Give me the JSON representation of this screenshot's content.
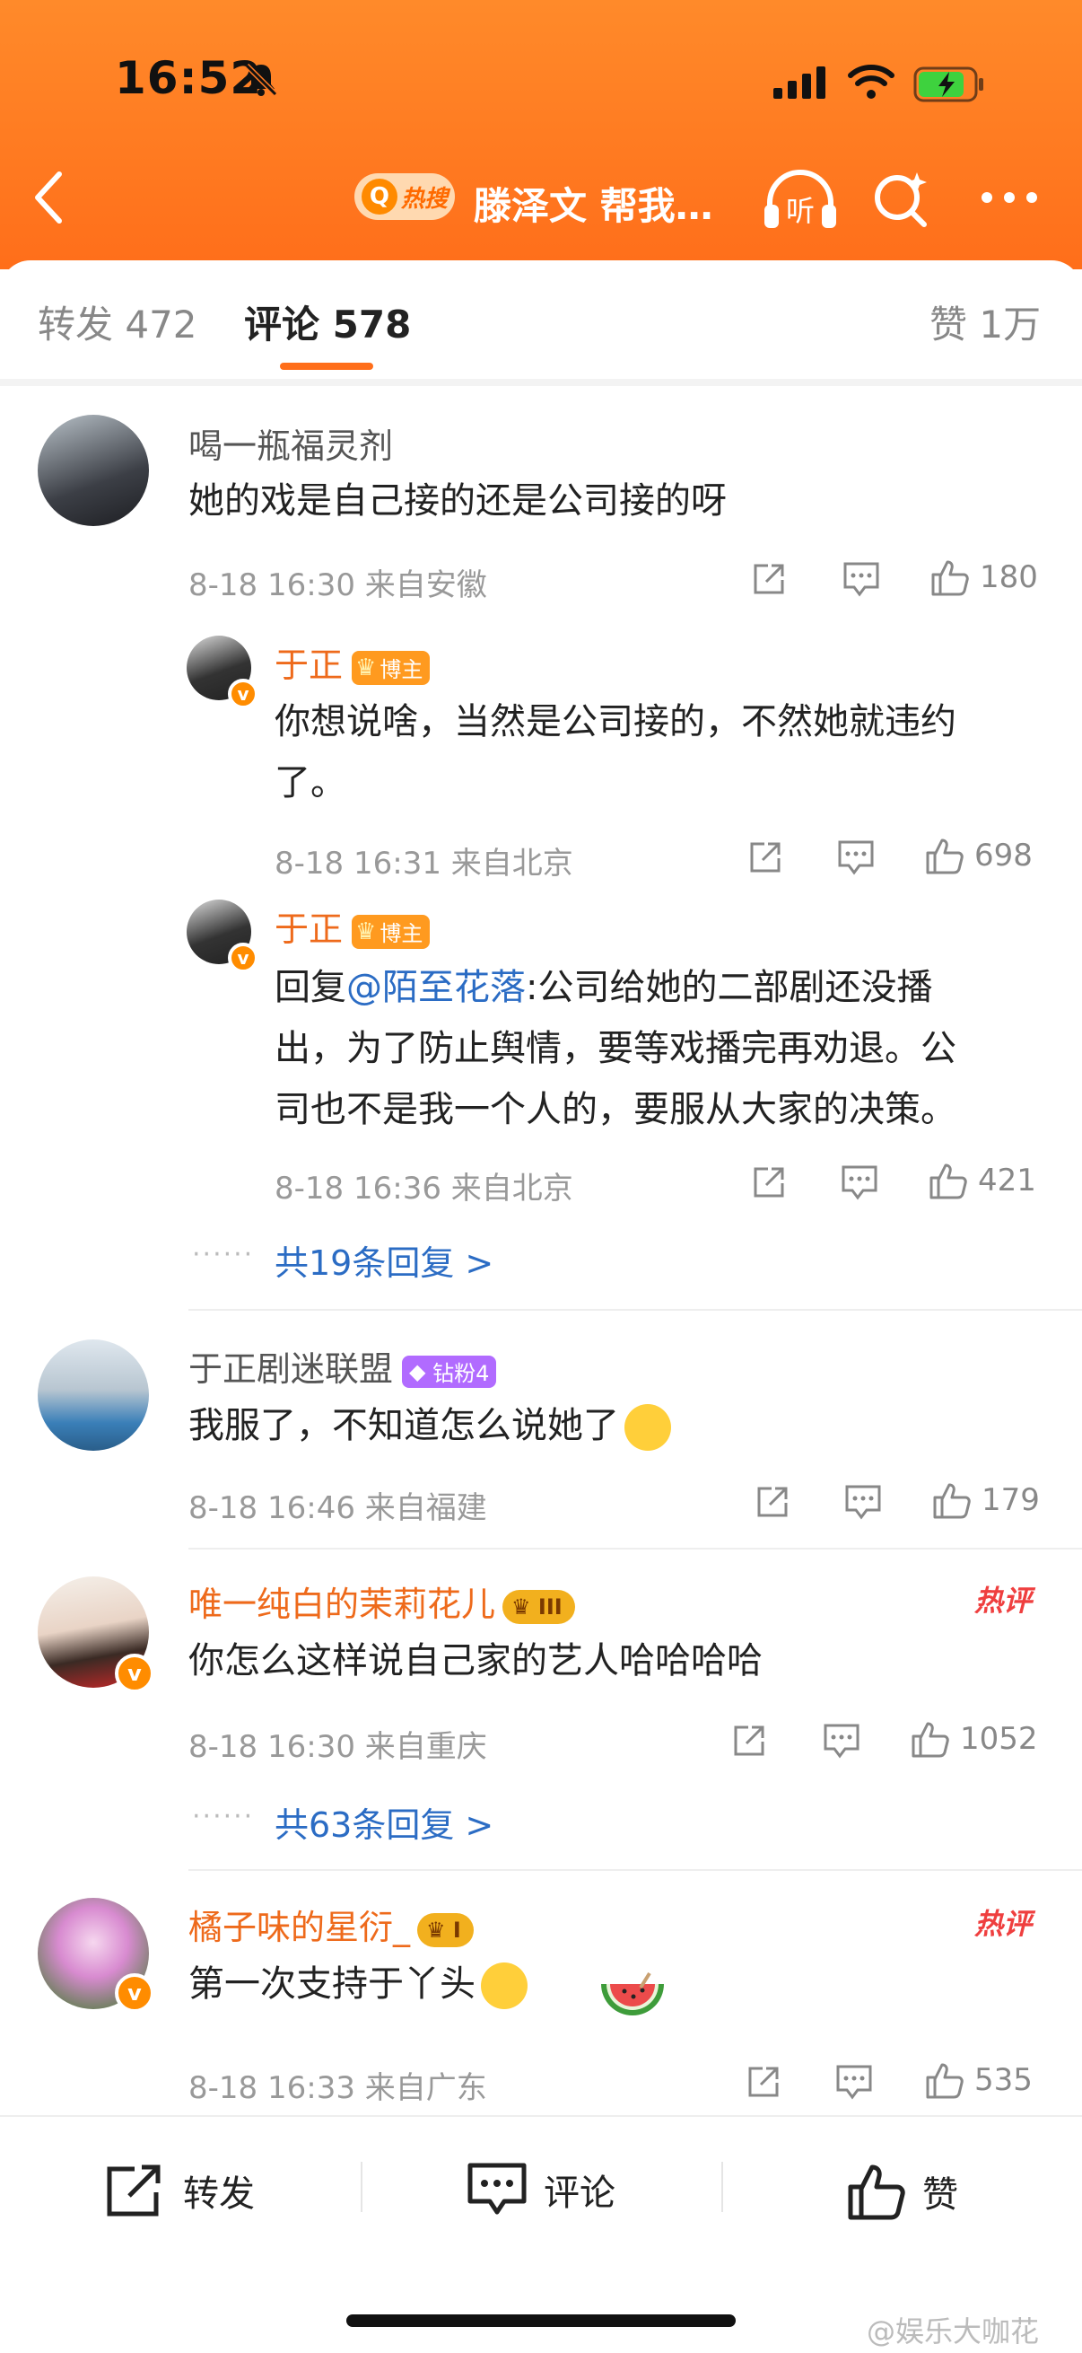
{
  "status_bar": {
    "time": "16:52"
  },
  "nav": {
    "hot_label": "热搜",
    "title": "滕泽文 帮我…",
    "listen_label": "听"
  },
  "tabs": {
    "repost": "转发 472",
    "comment": "评论 578",
    "like": "赞 1万"
  },
  "comments": [
    {
      "user": "喝一瓶福灵剂",
      "text": "她的戏是自己接的还是公司接的呀",
      "meta": "8-18 16:30  来自安徽",
      "likes": "180",
      "replies": [
        {
          "user": "于正",
          "badge": "博主",
          "text_l1": "你想说啥，当然是公司接的，不然她就违约",
          "text_l2": "了。",
          "meta": "8-18 16:31  来自北京",
          "likes": "698"
        },
        {
          "user": "于正",
          "badge": "博主",
          "reply_prefix": "回复",
          "mention": "@陌至花落",
          "text_l1": ":公司给她的二部剧还没播",
          "text_l2": "出，为了防止舆情，要等戏播完再劝退。公",
          "text_l3": "司也不是我一个人的，要服从大家的决策。",
          "meta": "8-18 16:36  来自北京",
          "likes": "421"
        }
      ],
      "more": "共19条回复 >"
    },
    {
      "user": "于正剧迷联盟",
      "badge": "钻粉4",
      "text": "我服了，不知道怎么说她了",
      "meta": "8-18 16:46  来自福建",
      "likes": "179"
    },
    {
      "user": "唯一纯白的茉莉花儿",
      "level": "III",
      "hot": "热评",
      "text": "你怎么这样说自己家的艺人哈哈哈哈",
      "meta": "8-18 16:30  来自重庆",
      "likes": "1052",
      "more": "共63条回复 >"
    },
    {
      "user": "橘子味的星衍_",
      "level": "I",
      "hot": "热评",
      "text": "第一次支持于丫头",
      "meta": "8-18 16:33  来自广东",
      "likes": "535"
    }
  ],
  "bottom": {
    "repost": "转发",
    "comment": "评论",
    "like": "赞"
  },
  "watermark": "@娱乐大咖花",
  "colors": {
    "header": "#ff7a22",
    "accent": "#ee6a1b",
    "link": "#2b6cc4",
    "hot": "#ef3f3f"
  }
}
